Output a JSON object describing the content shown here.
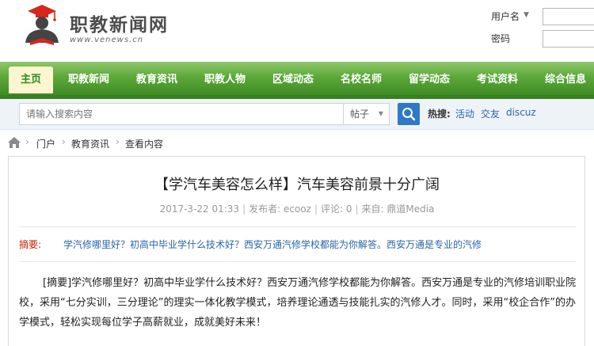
{
  "site": {
    "name": "职教新闻网",
    "url": "www.venews.cn"
  },
  "login": {
    "username_label": "用户名",
    "password_label": "密码"
  },
  "nav": {
    "items": [
      {
        "label": "主页",
        "active": true
      },
      {
        "label": "职教新闻"
      },
      {
        "label": "教育资讯"
      },
      {
        "label": "职教人物"
      },
      {
        "label": "区域动态"
      },
      {
        "label": "名校名师"
      },
      {
        "label": "留学动态"
      },
      {
        "label": "考试资料"
      },
      {
        "label": "综合信息"
      }
    ]
  },
  "search": {
    "placeholder": "请输入搜索内容",
    "type_selected": "帖子",
    "hot_label": "热搜:",
    "hot_links": [
      "活动",
      "交友",
      "discuz"
    ]
  },
  "breadcrumb": {
    "items": [
      "门户",
      "教育资讯",
      "查看内容"
    ]
  },
  "article": {
    "title": "【学汽车美容怎么样】汽车美容前景十分广阔",
    "date": "2017-3-22 01:33",
    "author": "发布者: ecooz",
    "comments": "评论: 0",
    "source": "来自: 鼎道Media",
    "summary_label": "摘要:",
    "summary": "学汽修哪里好？初高中毕业学什么技术好？西安万通汽修学校都能为你解答。西安万通是专业的汽修",
    "body": "[摘要]学汽修哪里好？初高中毕业学什么技术好？西安万通汽修学校都能为你解答。西安万通是专业的汽修培训职业院校，采用“七分实训，三分理论”的理实一体化教学模式，培养理论通透与技能扎实的汽修人才。同时，采用“校企合作”的办学模式，轻松实现每位学子高薪就业，成就美好未来！"
  },
  "colors": {
    "nav_green": "#5ca83a",
    "nav_active_bg": "#fbf6cf",
    "link_blue": "#2a66a8",
    "summary_red": "#cc2200",
    "search_button": "#2f79c4"
  },
  "icons": [
    "graduate-logo-icon",
    "search-icon",
    "home-icon",
    "caret-down-icon"
  ]
}
